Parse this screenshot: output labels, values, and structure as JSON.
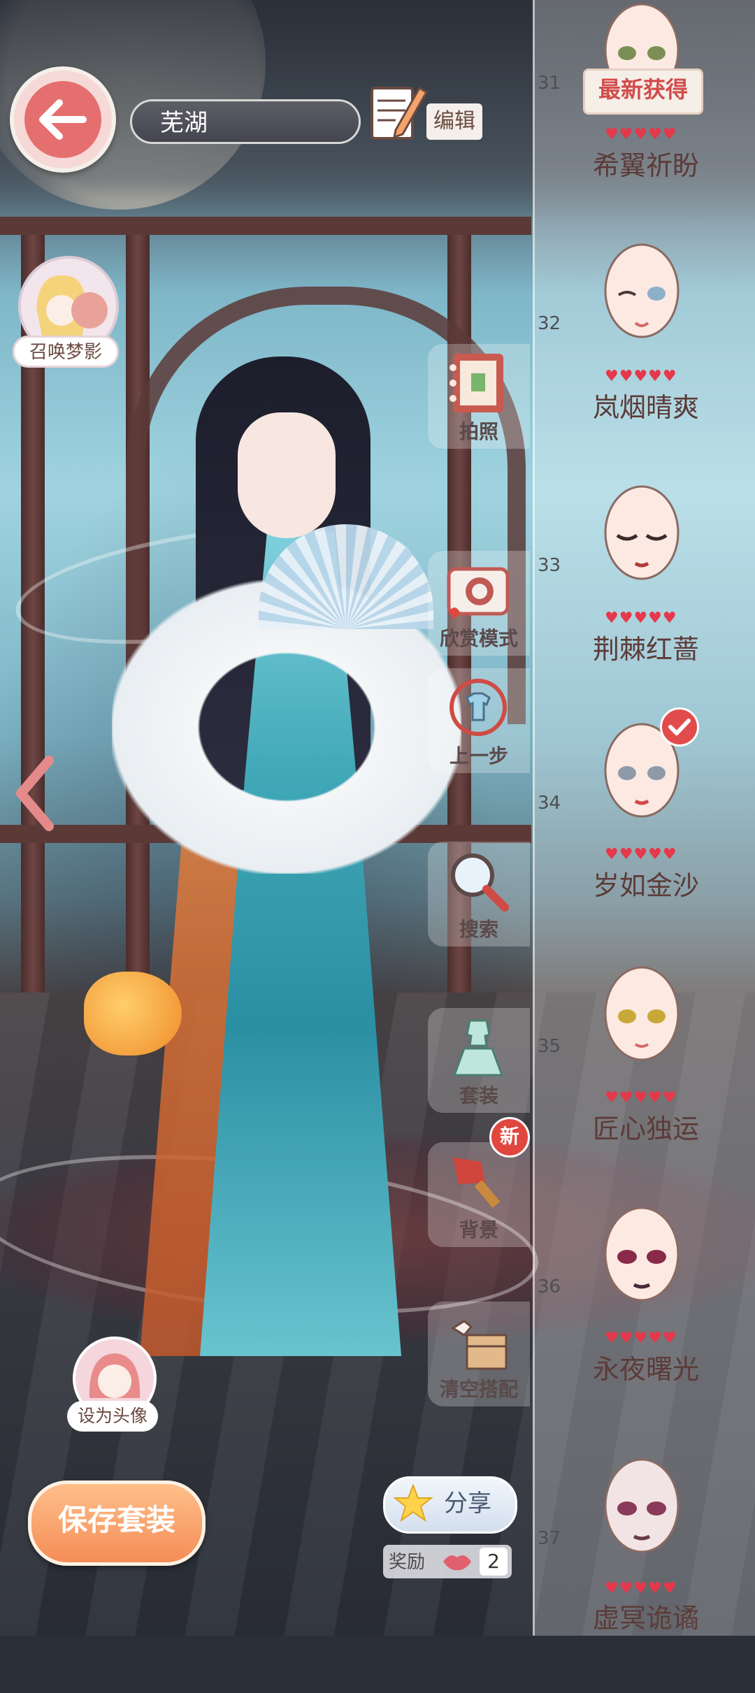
{
  "header": {
    "location_name": "芜湖",
    "edit_label": "编辑"
  },
  "summon": {
    "label": "召唤梦影"
  },
  "menu": {
    "items": [
      {
        "label": "拍照",
        "icon": "notebook-icon"
      },
      {
        "label": "欣赏模式",
        "icon": "camera-icon"
      },
      {
        "label": "上一步",
        "icon": "undo-shirt-icon"
      },
      {
        "label": "搜索",
        "icon": "magnifier-icon"
      },
      {
        "label": "套装",
        "icon": "outfit-icon"
      },
      {
        "label": "背景",
        "icon": "brush-icon"
      },
      {
        "label": "清空搭配",
        "icon": "clear-box-icon"
      }
    ],
    "new_badge": "新"
  },
  "panel": {
    "latest_tag": "最新获得",
    "cards": [
      {
        "number": "31",
        "hearts": "♥♥♥♥♥",
        "title": "希翼祈盼"
      },
      {
        "number": "32",
        "hearts": "♥♥♥♥♥",
        "title": "岚烟晴爽"
      },
      {
        "number": "33",
        "hearts": "♥♥♥♥♥",
        "title": "荆棘红蔷"
      },
      {
        "number": "34",
        "hearts": "♥♥♥♥♥",
        "title": "岁如金沙",
        "selected": true
      },
      {
        "number": "35",
        "hearts": "♥♥♥♥♥",
        "title": "匠心独运"
      },
      {
        "number": "36",
        "hearts": "♥♥♥♥♥",
        "title": "永夜曙光"
      },
      {
        "number": "37",
        "hearts": "♥♥♥♥♥",
        "title": "虚冥诡谲"
      }
    ]
  },
  "bottom": {
    "avatar_label": "设为头像",
    "save_label": "保存套装",
    "share_label": "分享",
    "reward_label": "奖励",
    "reward_count": "2"
  },
  "colors": {
    "accent_red": "#e56f6f",
    "save_orange": "#f48d56",
    "heart_red": "#e5384a"
  }
}
